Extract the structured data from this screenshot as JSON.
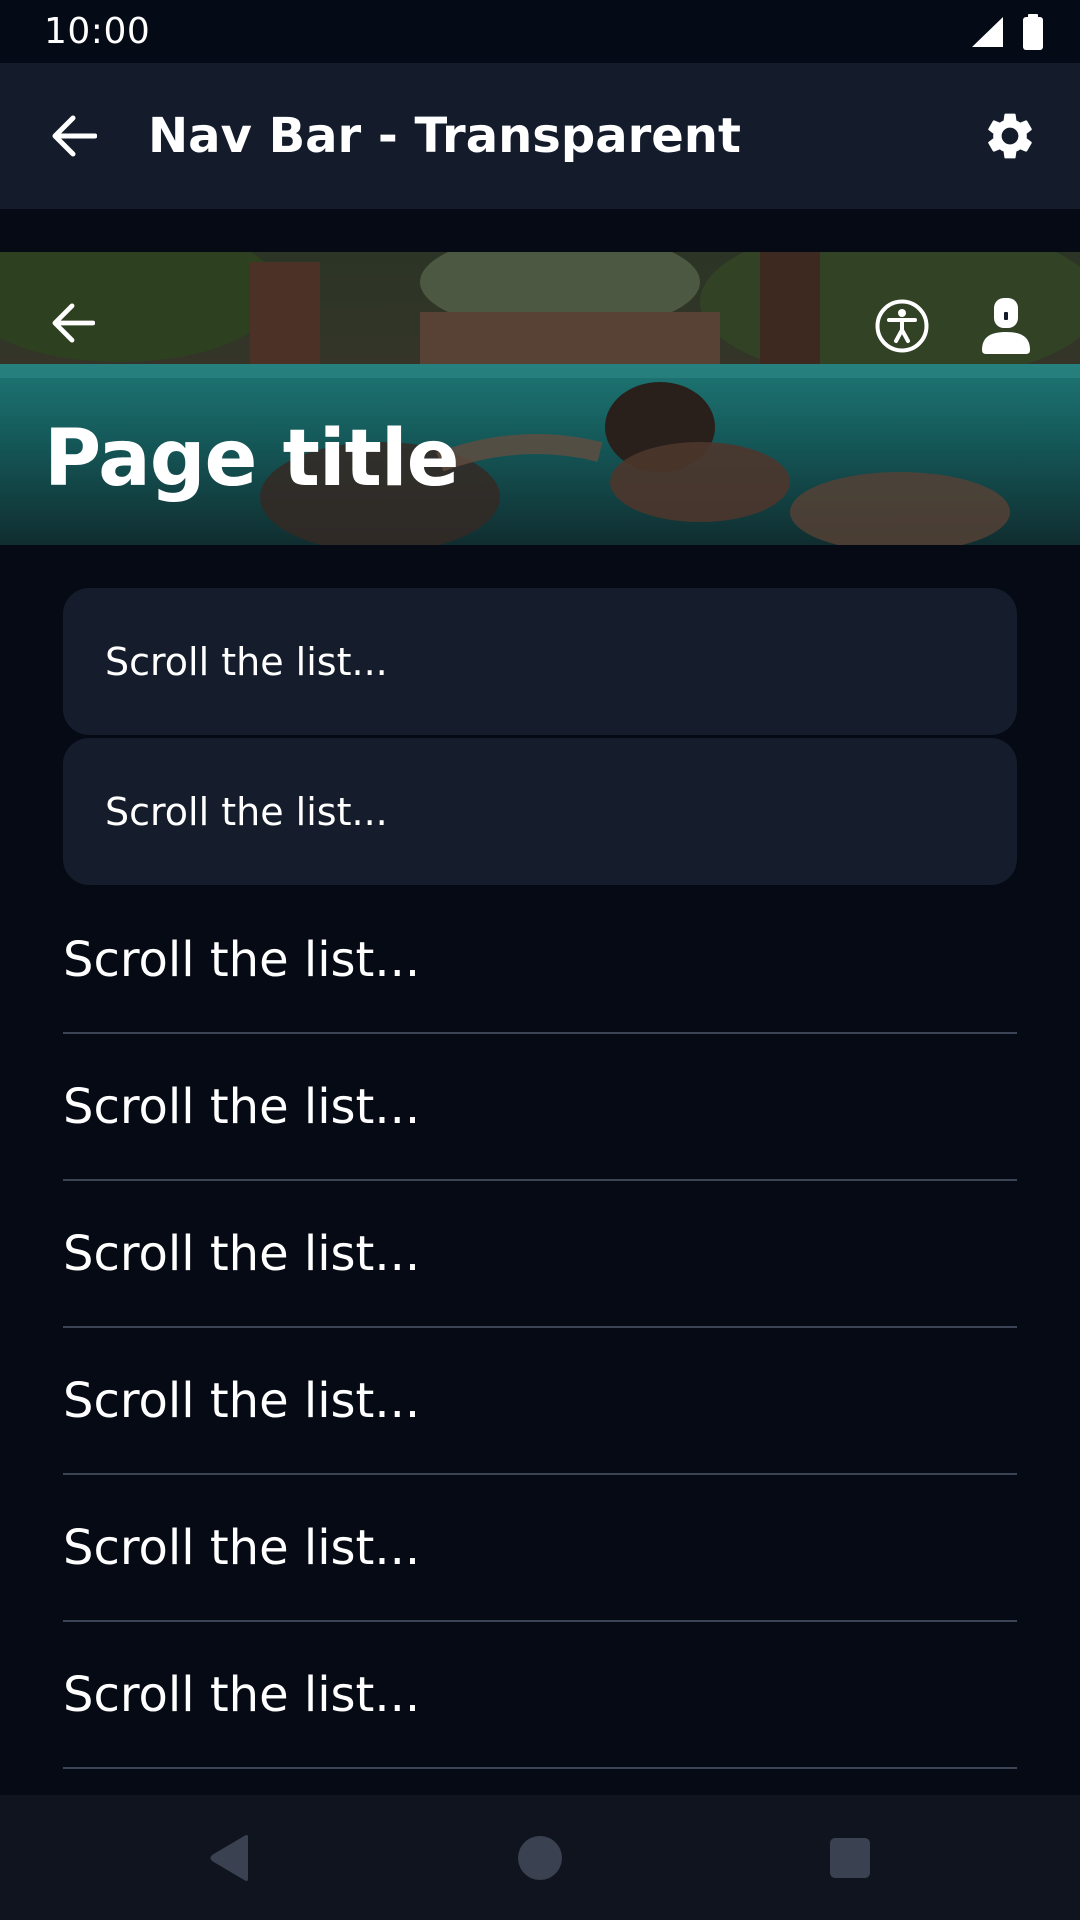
{
  "status_bar": {
    "time": "10:00",
    "icons": [
      "signal-icon",
      "battery-icon"
    ]
  },
  "app_bar": {
    "title": "Nav Bar - Transparent",
    "back_icon": "arrow-back-icon",
    "settings_icon": "gear-icon"
  },
  "hero": {
    "title": "Page title",
    "back_icon": "arrow-back-icon",
    "action_icons": [
      "accessibility-icon",
      "person-icon"
    ]
  },
  "list": {
    "cards": [
      {
        "label": "Scroll the list..."
      },
      {
        "label": "Scroll the list..."
      }
    ],
    "rows": [
      {
        "label": "Scroll the list..."
      },
      {
        "label": "Scroll the list..."
      },
      {
        "label": "Scroll the list..."
      },
      {
        "label": "Scroll the list..."
      },
      {
        "label": "Scroll the list..."
      },
      {
        "label": "Scroll the list..."
      }
    ]
  },
  "nav_bar": {
    "icons": [
      "back-triangle-icon",
      "home-circle-icon",
      "recents-square-icon"
    ]
  },
  "colors": {
    "background": "#050a14",
    "app_bar": "#141c2b",
    "card": "#151d2c",
    "divider": "#3b4556",
    "nav_bar": "#0f141e",
    "water": "#1f8a8a"
  }
}
